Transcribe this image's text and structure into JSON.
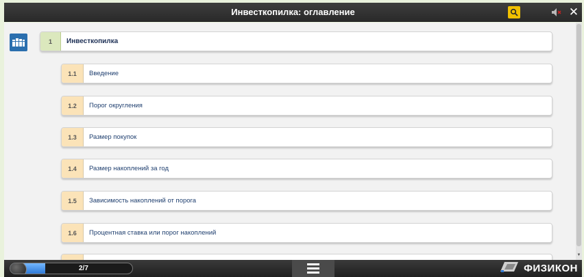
{
  "header": {
    "title": "Инвесткопилка: оглавление"
  },
  "toc": {
    "chapter": {
      "number": "1",
      "title": "Инвесткопилка"
    },
    "sections": [
      {
        "number": "1.1",
        "title": "Введение"
      },
      {
        "number": "1.2",
        "title": "Порог округления"
      },
      {
        "number": "1.3",
        "title": "Размер покупок"
      },
      {
        "number": "1.4",
        "title": "Размер накоплений за год"
      },
      {
        "number": "1.5",
        "title": "Зависимость накоплений от порога"
      },
      {
        "number": "1.6",
        "title": "Процентная ставка или порог накоплений"
      },
      {
        "number": "",
        "title": ""
      }
    ]
  },
  "footer": {
    "progress_text": "2/7",
    "progress_fraction": 0.2857,
    "brand": "ФИЗИКОН"
  },
  "colors": {
    "chapter_badge": "#dbe8bd",
    "section_badge": "#fbe3b8",
    "accent_blue": "#2b6fae",
    "search_yellow": "#f0c000"
  },
  "icons": {
    "book": "book-icon",
    "search": "search-icon",
    "sound": "sound-muted-icon",
    "close": "close-icon",
    "menu": "menu-icon",
    "brand": "physicon-logo-icon"
  }
}
